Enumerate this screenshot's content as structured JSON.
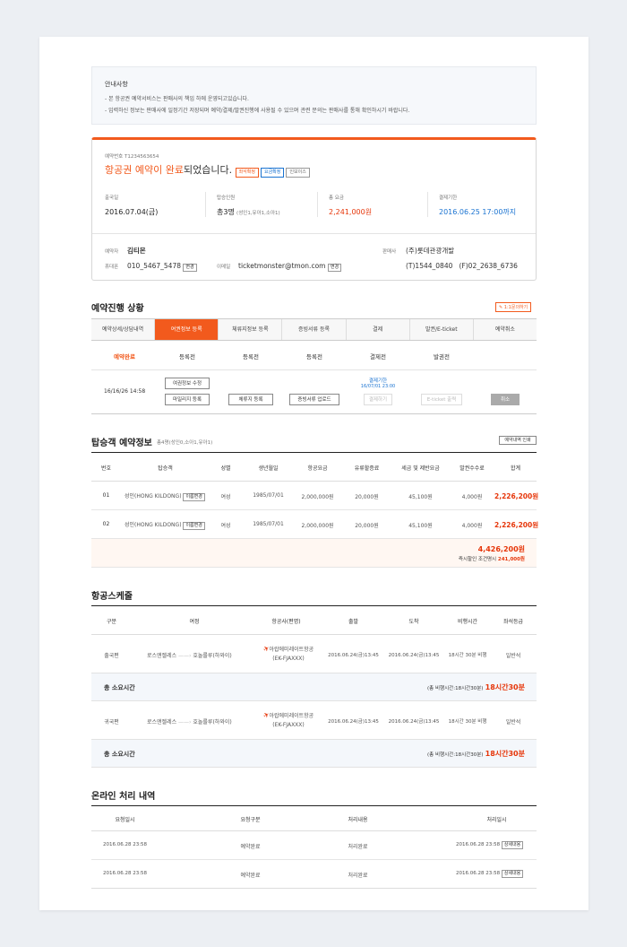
{
  "notice": {
    "title": "안내사항",
    "line1": "- 본 항공권 예약서비스는 판매사의 책임 하에 운영되고있습니다.",
    "line2": "- 입력하신 정보는 판매사에 일정기간 저장되며 예약/결제/발권진행에 사용될 수 있으며 관련 문의는 판매사를 통해 확인하시기 바랍니다."
  },
  "reservation": {
    "number_label": "예약번호 T1234563654",
    "headline_prefix": "항공권 ",
    "headline_accent": "예약이 완료",
    "headline_suffix": "되었습니다.",
    "tags": [
      "좌석확정",
      "요금확정",
      "인보이스"
    ],
    "departure_label": "출국일",
    "departure_value": "2016.07.04(금)",
    "passengers_label": "탑승인원",
    "passengers_value": "총3명",
    "passengers_detail": "(성인1,유아1,소아1)",
    "fare_label": "총 요금",
    "fare_value": "2,241,000원",
    "deadline_label": "결제기한",
    "deadline_value": "2016.06.25 17:00까지",
    "booker_label": "예약자",
    "booker_name": "김티몬",
    "phone_label": "휴대폰",
    "phone_value": "010_5467_5478",
    "change": "변경",
    "email_label": "이메일",
    "email_value": "ticketmonster@tmon.com",
    "seller_label": "판매사",
    "seller_name": "(주)롯데관광개발",
    "seller_tel": "(T)1544_0840",
    "seller_fax": "(F)02_2638_6736"
  },
  "progress": {
    "title": "예약진행 상황",
    "inquiry_btn": "1:1문의하기",
    "steps": [
      "예약상세/상담내역",
      "여권정보 등록",
      "체류지정보 등록",
      "증빙서류 등록",
      "결제",
      "발권/E-ticket",
      "예약취소"
    ],
    "statuses": [
      "예약완료",
      "등록전",
      "등록전",
      "등록전",
      "결제전",
      "발권전"
    ],
    "date": "16/16/26 14:58",
    "btn_passport_edit": "여권정보 수정",
    "btn_mileage": "마일리지 등록",
    "btn_stay": "체류지 등록",
    "btn_docs": "증빙서류 업로드",
    "pay_deadline_label": "결제기한",
    "pay_deadline_date": "16/07/01 23:00",
    "btn_pay": "결제하기",
    "btn_eticket": "E-ticket 출력",
    "btn_cancel": "취소"
  },
  "passengers": {
    "title": "탑승객 예약정보",
    "subtitle": "총4명(성인0,소아1,유아1)",
    "print_btn": "예약내역 인쇄",
    "headers": [
      "번호",
      "탑승객",
      "성별",
      "생년월일",
      "항공요금",
      "유류할증료",
      "세금 및 제반요금",
      "발권수수료",
      "합계"
    ],
    "rows": [
      {
        "no": "01",
        "name": "성인(HONG KILDONG)",
        "btn": "이름변경",
        "gender": "여성",
        "birth": "1985/07/01",
        "fare": "2,000,000원",
        "fuel": "20,000원",
        "tax": "45,100원",
        "fee": "4,000원",
        "total": "2,226,200원"
      },
      {
        "no": "02",
        "name": "성인(HONG KILDONG)",
        "btn": "이름변경",
        "gender": "여성",
        "birth": "1985/07/01",
        "fare": "2,000,000원",
        "fuel": "20,000원",
        "tax": "45,100원",
        "fee": "4,000원",
        "total": "2,226,200원"
      }
    ],
    "grand_total": "4,426,200원",
    "discount_label": "즉시할인 조건명시",
    "discount_value": "241,000원"
  },
  "schedule": {
    "title": "항공스케줄",
    "headers": [
      "구분",
      "여정",
      "항공사(편명)",
      "출발",
      "도착",
      "비행시간",
      "좌석등급"
    ],
    "rows": [
      {
        "type": "출국편",
        "from": "로스앤젤레스",
        "to": "호놀룰루(하와이)",
        "airline": "아랍에미레이트항공",
        "flight": "(EK-FJAXXX)",
        "dep": "2016.06.24(금)13:45",
        "arr": "2016.06.24(금)13:45",
        "dur": "18시간 30분 비행",
        "cls": "일반석"
      },
      {
        "type": "귀국편",
        "from": "로스앤젤레스",
        "to": "호놀룰루(하와이)",
        "airline": "아랍에미레이트항공",
        "flight": "(EK-FJAXXX)",
        "dep": "2016.06.24(금)13:45",
        "arr": "2016.06.24(금)13:45",
        "dur": "18시간 30분 비행",
        "cls": "일반석"
      }
    ],
    "total_label": "총 소요시간",
    "total_detail": "(총 비행시간:18시간30분)",
    "total_value": "18시간30분"
  },
  "online": {
    "title": "온라인 처리 내역",
    "headers": [
      "요청일시",
      "요청구분",
      "처리내용",
      "처리일시"
    ],
    "rows": [
      {
        "req": "2016.06.28 23:58",
        "type": "예약완료",
        "content": "처리완료",
        "done": "2016.06.28 23:58",
        "btn": "상세내용"
      },
      {
        "req": "2016.06.28 23:58",
        "type": "예약완료",
        "content": "처리완료",
        "done": "2016.06.28 23:58",
        "btn": "상세내용"
      }
    ]
  },
  "colors": {
    "accent": "#f25a1d",
    "price": "#e6360a",
    "blue": "#1a73d1"
  }
}
